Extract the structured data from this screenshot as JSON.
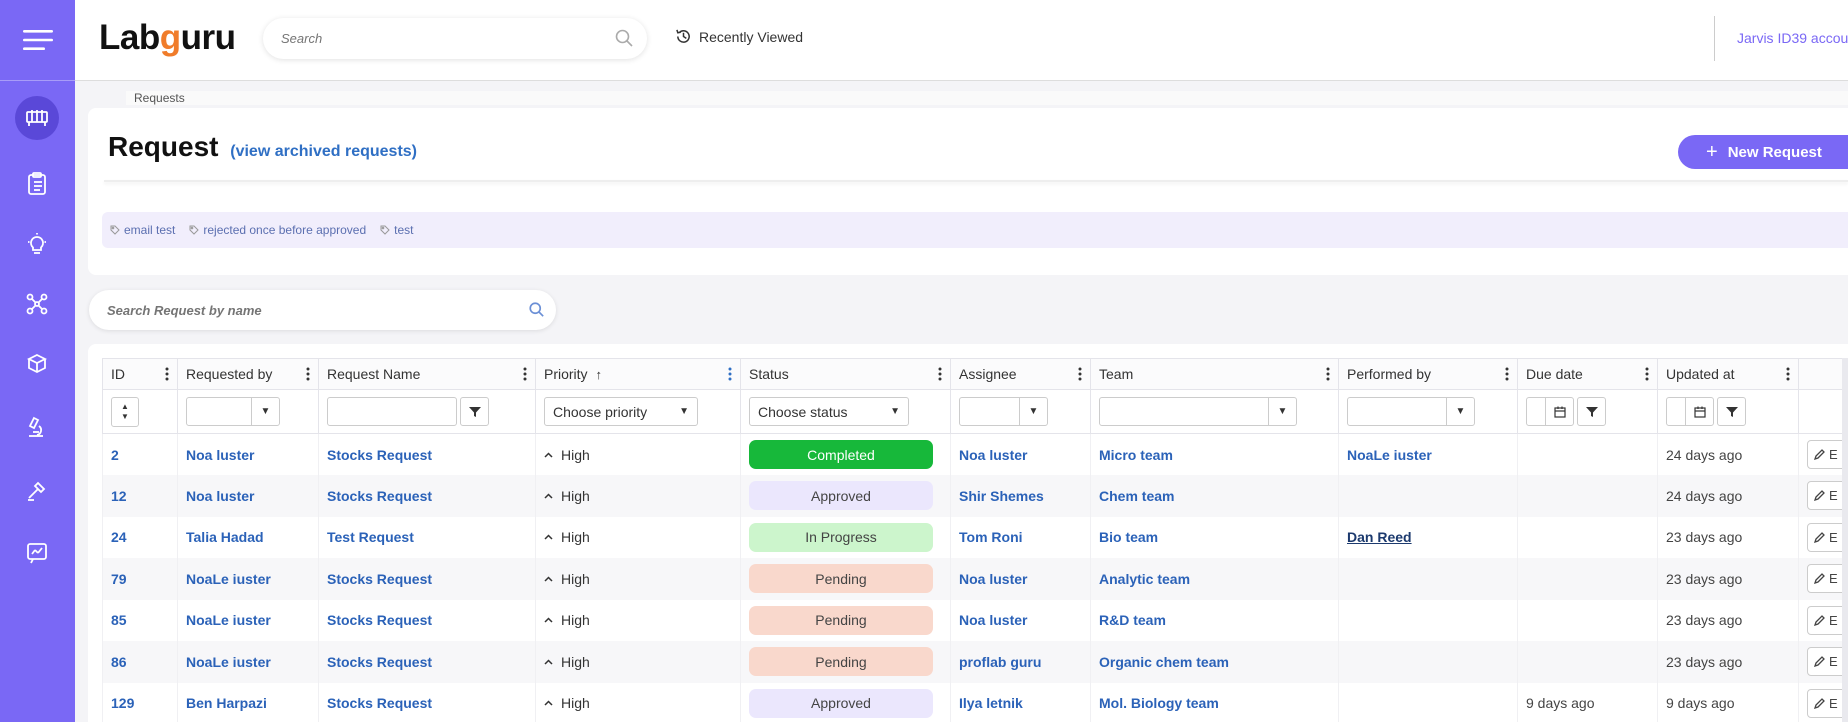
{
  "app": {
    "logo_prefix": "Lab",
    "logo_g": "g",
    "logo_suffix": "uru",
    "search_placeholder": "Search",
    "recently_viewed": "Recently Viewed",
    "account": "Jarvis ID39 accou",
    "accent_color": "#7a68f5"
  },
  "rail": {
    "icons": [
      "menu-icon",
      "equipment-icon",
      "checklist-icon",
      "idea-icon",
      "molecule-icon",
      "inventory-icon",
      "microscope-icon",
      "tools-icon",
      "report-icon"
    ]
  },
  "breadcrumb": "Requests",
  "page": {
    "title": "Request",
    "archived_link": "(view archived requests)",
    "new_button": "New Request",
    "tags": [
      "email test",
      "rejected once before approved",
      "test"
    ],
    "search_placeholder": "Search Request by name"
  },
  "table": {
    "columns": [
      "ID",
      "Requested by",
      "Request Name",
      "Priority",
      "Status",
      "Assignee",
      "Team",
      "Performed by",
      "Due date",
      "Updated at"
    ],
    "filters": {
      "priority": "Choose priority",
      "status": "Choose status"
    },
    "edit_label": "E",
    "rows": [
      {
        "id": "2",
        "requested_by": "Noa luster",
        "name": "Stocks Request",
        "priority": "High",
        "status": "Completed",
        "assignee": "Noa luster",
        "team": "Micro team",
        "performed_by": "NoaLe iuster",
        "due": "",
        "updated": "24 days ago"
      },
      {
        "id": "12",
        "requested_by": "Noa luster",
        "name": "Stocks Request",
        "priority": "High",
        "status": "Approved",
        "assignee": "Shir Shemes",
        "team": "Chem team",
        "performed_by": "",
        "due": "",
        "updated": "24 days ago"
      },
      {
        "id": "24",
        "requested_by": "Talia Hadad",
        "name": "Test Request",
        "priority": "High",
        "status": "In Progress",
        "assignee": "Tom Roni",
        "team": "Bio team",
        "performed_by": "Dan Reed",
        "due": "",
        "updated": "23 days ago"
      },
      {
        "id": "79",
        "requested_by": "NoaLe iuster",
        "name": "Stocks Request",
        "priority": "High",
        "status": "Pending",
        "assignee": "Noa luster",
        "team": "Analytic team",
        "performed_by": "",
        "due": "",
        "updated": "23 days ago"
      },
      {
        "id": "85",
        "requested_by": "NoaLe iuster",
        "name": "Stocks Request",
        "priority": "High",
        "status": "Pending",
        "assignee": "Noa luster",
        "team": "R&D team",
        "performed_by": "",
        "due": "",
        "updated": "23 days ago"
      },
      {
        "id": "86",
        "requested_by": "NoaLe iuster",
        "name": "Stocks Request",
        "priority": "High",
        "status": "Pending",
        "assignee": "proflab guru",
        "team": "Organic chem team",
        "performed_by": "",
        "due": "",
        "updated": "23 days ago"
      },
      {
        "id": "129",
        "requested_by": "Ben Harpazi",
        "name": "Stocks Request",
        "priority": "High",
        "status": "Approved",
        "assignee": "Ilya letnik",
        "team": "Mol. Biology team",
        "performed_by": "",
        "due": "9 days ago",
        "updated": "9 days ago"
      }
    ]
  }
}
